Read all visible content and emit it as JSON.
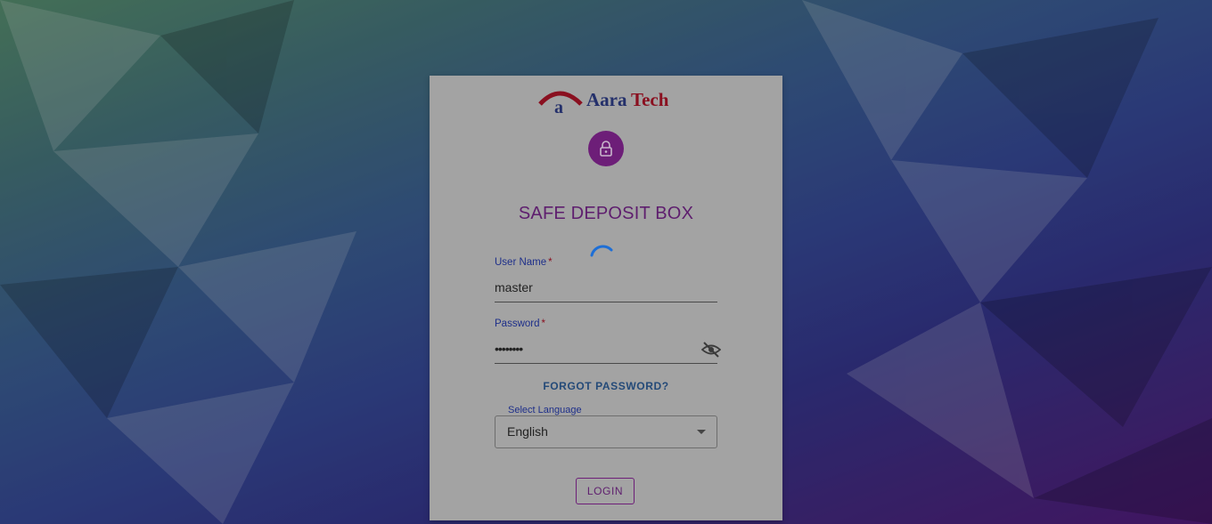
{
  "brand": {
    "letter": "a",
    "name_part1": "Aara",
    "name_part2": "Tech"
  },
  "icons": {
    "lock": "lock-icon",
    "eye_off": "eye-off-icon",
    "caret": "caret-down-icon",
    "spinner": "loading-spinner-icon"
  },
  "title": "SAFE DEPOSIT BOX",
  "username": {
    "label": "User Name",
    "required_mark": "*",
    "value": "master"
  },
  "password": {
    "label": "Password",
    "required_mark": "*",
    "value": "••••••••"
  },
  "forgot_password": "FORGOT PASSWORD?",
  "language": {
    "label": "Select Language",
    "value": "English"
  },
  "login_label": "LOGIN",
  "colors": {
    "accent": "#6d1e78",
    "link": "#244a78",
    "brand_red": "#8a1020",
    "brand_navy": "#24306b"
  }
}
